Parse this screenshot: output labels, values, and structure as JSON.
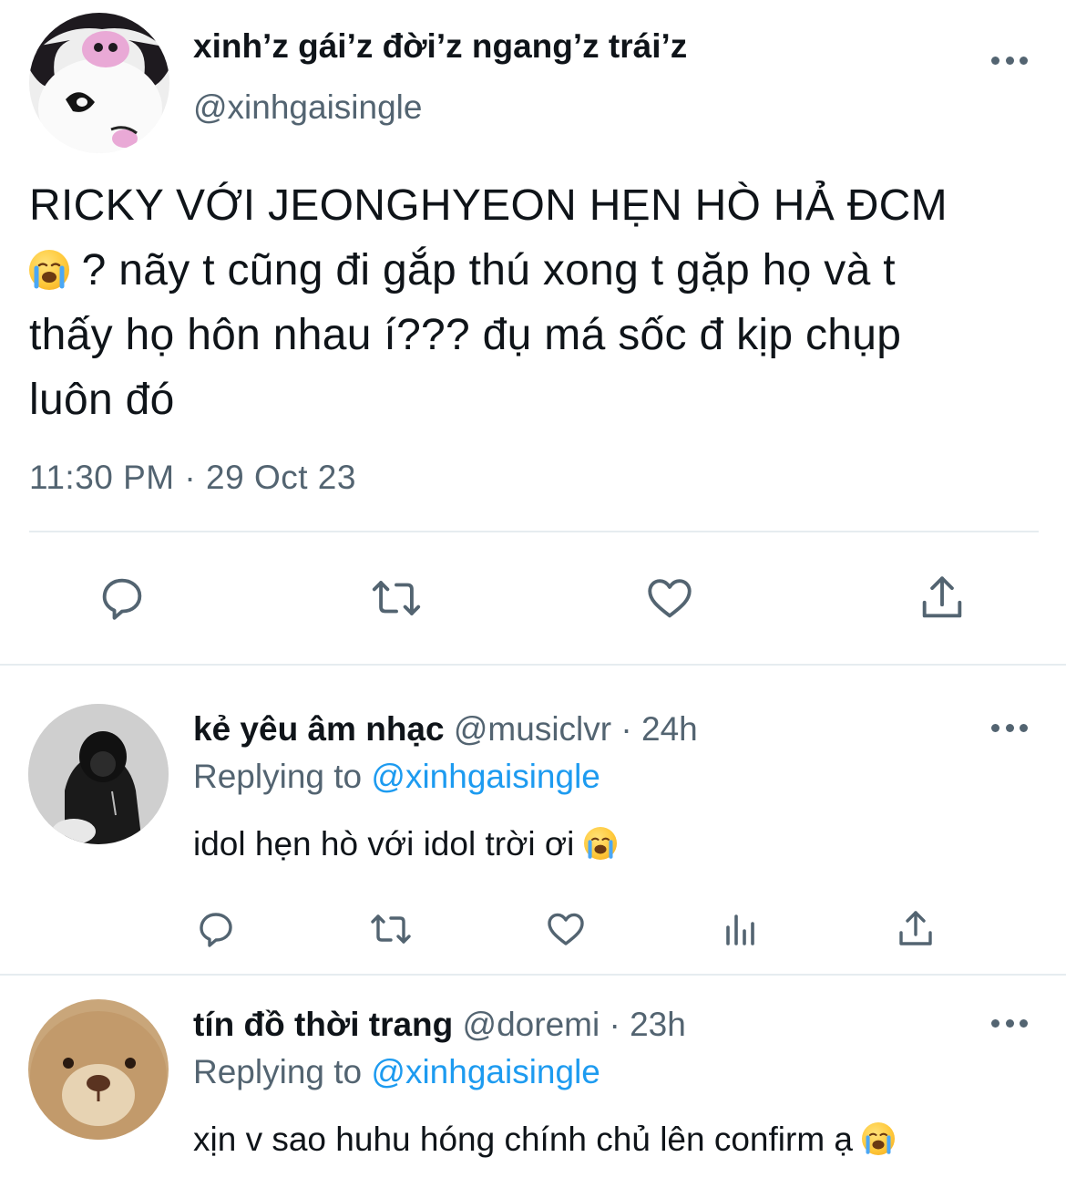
{
  "tweet": {
    "display_name": "xinh’z gái’z đời’z ngang’z trái’z",
    "handle": "@xinhgaisingle",
    "text_line1": "RICKY VỚI JEONGHYEON HẸN HÒ HẢ ĐCM",
    "text_line2": " ? nãy t cũng đi gắp thú xong t gặp họ và t",
    "text_line3": "thấy họ hôn nhau í??? đụ má sốc đ kịp chụp",
    "text_line4": "luôn đó",
    "timestamp": "11:30 PM · 29 Oct 23",
    "emoji": "loudly-crying-face"
  },
  "replies": [
    {
      "display_name": "kẻ yêu âm nhạc",
      "handle": "@musiclvr",
      "time": "· 24h",
      "replying_prefix": "Replying to ",
      "replying_handle": "@xinhgaisingle",
      "text": "idol hẹn hò với idol trời ơi ",
      "emoji": "loudly-crying-face"
    },
    {
      "display_name": "tín đồ thời trang",
      "handle": "@doremi",
      "time": "· 23h",
      "replying_prefix": "Replying to ",
      "replying_handle": "@xinhgaisingle",
      "text": "xịn v sao huhu hóng chính chủ lên confirm ạ ",
      "emoji": "loudly-crying-face"
    }
  ],
  "icons": {
    "reply": "comment-icon",
    "retweet": "retweet-icon",
    "like": "heart-icon",
    "share": "share-icon",
    "views": "analytics-icon",
    "more": "more-dots-icon"
  },
  "colors": {
    "text": "#0f1419",
    "secondary": "#536471",
    "link": "#1d9bf0",
    "divider": "#e6ecf0"
  }
}
